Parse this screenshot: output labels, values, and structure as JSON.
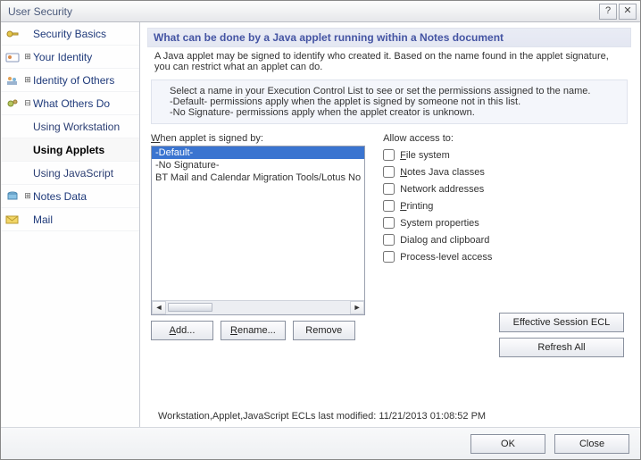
{
  "title": "User Security",
  "sidebar": {
    "items": [
      {
        "label": "Security Basics",
        "expandable": false
      },
      {
        "label": "Your Identity",
        "expandable": true
      },
      {
        "label": "Identity of Others",
        "expandable": true
      },
      {
        "label": "What Others Do",
        "expandable": true,
        "expanded": true,
        "children": [
          {
            "label": "Using Workstation"
          },
          {
            "label": "Using Applets",
            "selected": true
          },
          {
            "label": "Using JavaScript"
          }
        ]
      },
      {
        "label": "Notes Data",
        "expandable": true
      },
      {
        "label": "Mail",
        "expandable": false
      }
    ]
  },
  "main": {
    "banner": "What can be done by a Java applet running within a Notes document",
    "desc": "A Java applet may be signed to identify who created it.  Based on the name found in the applet signature, you can restrict what an applet can do.",
    "info_line1": "Select a name in your Execution Control List to see or set the permissions assigned to the name.",
    "info_line2": "-Default- permissions apply when the applet is signed by someone not in this list.",
    "info_line3": "-No Signature- permissions apply when the applet creator is unknown.",
    "list_label_pre": "",
    "list_label_hot": "W",
    "list_label_post": "hen applet is signed by:",
    "signers": [
      {
        "label": "-Default-",
        "selected": true
      },
      {
        "label": "-No Signature-"
      },
      {
        "label": "BT Mail and Calendar Migration Tools/Lotus No"
      }
    ],
    "allow_label": "Allow access to:",
    "perms": [
      {
        "hot": "F",
        "rest": "ile system"
      },
      {
        "hot": "N",
        "rest": "otes Java classes"
      },
      {
        "plain": "Network addresses"
      },
      {
        "hot": "P",
        "rest": "rinting"
      },
      {
        "plain": "System properties"
      },
      {
        "plain": "Dialog and clipboard"
      },
      {
        "plain": "Process-level access"
      }
    ],
    "btn_add_hot": "A",
    "btn_add_rest": "dd...",
    "btn_rename_hot": "R",
    "btn_rename_rest": "ename...",
    "btn_remove": "Remove",
    "btn_effective": "Effective Session ECL",
    "btn_refresh": "Refresh All",
    "status": "Workstation,Applet,JavaScript ECLs last modified:  11/21/2013 01:08:52 PM"
  },
  "footer": {
    "ok": "OK",
    "close": "Close"
  }
}
